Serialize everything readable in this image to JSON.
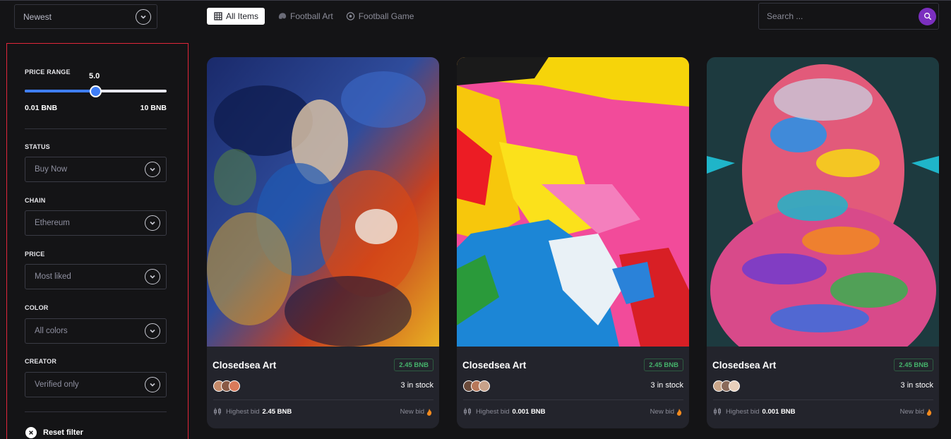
{
  "sort": {
    "selected": "Newest"
  },
  "tabs": [
    {
      "label": "All Items",
      "icon": "grid-icon",
      "active": true
    },
    {
      "label": "Football Art",
      "icon": "football-helmet-icon",
      "active": false
    },
    {
      "label": "Football Game",
      "icon": "soccer-ball-icon",
      "active": false
    }
  ],
  "search": {
    "placeholder": "Search ...",
    "value": "",
    "button_icon": "search-icon"
  },
  "filters": {
    "price_range": {
      "label": "PRICE RANGE",
      "value_display": "5.0",
      "value": 5.0,
      "min": 0.01,
      "max": 10,
      "min_label": "0.01 BNB",
      "max_label": "10 BNB"
    },
    "status": {
      "label": "STATUS",
      "selected": "Buy Now"
    },
    "chain": {
      "label": "CHAIN",
      "selected": "Ethereum"
    },
    "price": {
      "label": "PRICE",
      "selected": "Most liked"
    },
    "color": {
      "label": "COLOR",
      "selected": "All colors"
    },
    "creator": {
      "label": "CREATOR",
      "selected": "Verified only"
    },
    "reset_label": "Reset filter"
  },
  "cards": [
    {
      "title": "Closedsea Art",
      "price": "2.45 BNB",
      "stock": "3 in stock",
      "bid_label": "Highest bid",
      "bid_value": "2.45 BNB",
      "new_bid": "New bid"
    },
    {
      "title": "Closedsea Art",
      "price": "2.45 BNB",
      "stock": "3 in stock",
      "bid_label": "Highest bid",
      "bid_value": "0.001 BNB",
      "new_bid": "New bid"
    },
    {
      "title": "Closedsea Art",
      "price": "2.45 BNB",
      "stock": "3 in stock",
      "bid_label": "Highest bid",
      "bid_value": "0.001 BNB",
      "new_bid": "New bid"
    }
  ],
  "colors": {
    "accent_blue": "#3f7ef8",
    "search_purple": "#7b2fbf",
    "price_green": "#45b26b",
    "filter_border_red": "#e0263a"
  }
}
